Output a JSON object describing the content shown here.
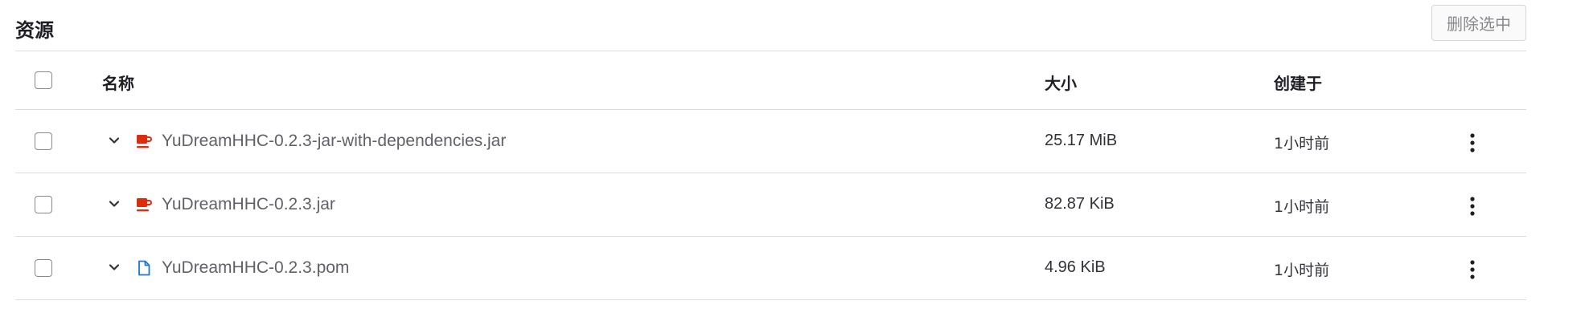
{
  "section": {
    "title": "资源",
    "delete_label": "删除选中"
  },
  "table": {
    "headers": {
      "name": "名称",
      "size": "大小",
      "created": "创建于"
    },
    "rows": [
      {
        "name": "YuDreamHHC-0.2.3-jar-with-dependencies.jar",
        "size": "25.17 MiB",
        "created": "1小时前",
        "icon": "jar-icon"
      },
      {
        "name": "YuDreamHHC-0.2.3.jar",
        "size": "82.87 KiB",
        "created": "1小时前",
        "icon": "jar-icon"
      },
      {
        "name": "YuDreamHHC-0.2.3.pom",
        "size": "4.96 KiB",
        "created": "1小时前",
        "icon": "document-icon"
      }
    ]
  },
  "colors": {
    "jar_icon": "#dd2b0e",
    "document_icon": "#1f75cb"
  }
}
